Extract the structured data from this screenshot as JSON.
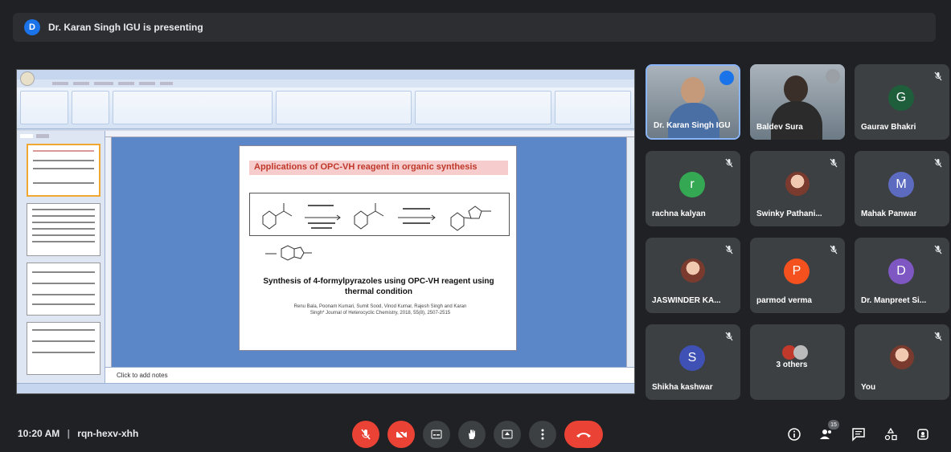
{
  "banner": {
    "avatar_letter": "D",
    "text": "Dr. Karan Singh IGU is presenting"
  },
  "presentation": {
    "slide_title": "Applications of OPC-VH reagent in organic synthesis",
    "slide_subtitle": "Synthesis of 4-formylpyrazoles using OPC-VH reagent using thermal condition",
    "citation_line1": "Renu Bala, Poonam Kumari, Sumit Sood, Vinod Kumar, Rajesh Singh and Karan",
    "citation_line2": "Singh* Journal of Heterocyclic Chemistry, 2018, 55(8), 2507-2515",
    "notes_placeholder": "Click to add notes"
  },
  "participants": [
    {
      "name": "Dr. Karan Singh IGU",
      "type": "video",
      "speaking": true
    },
    {
      "name": "Baldev Sura",
      "type": "video",
      "speaking": false
    },
    {
      "name": "Gaurav Bhakri",
      "letter": "G",
      "color": "#1e5e3b",
      "muted": true
    },
    {
      "name": "rachna kalyan",
      "letter": "r",
      "color": "#34a853",
      "muted": true
    },
    {
      "name": "Swinky Pathani...",
      "type": "photo",
      "muted": true
    },
    {
      "name": "Mahak Panwar",
      "letter": "M",
      "color": "#5c6bc0",
      "muted": true
    },
    {
      "name": "JASWINDER KA...",
      "type": "photo",
      "muted": true
    },
    {
      "name": "parmod verma",
      "letter": "P",
      "color": "#f4511e",
      "muted": true
    },
    {
      "name": "Dr. Manpreet Si...",
      "letter": "D",
      "color": "#7e57c2",
      "muted": true
    },
    {
      "name": "Shikha kashwar",
      "letter": "S",
      "color": "#3f51b5",
      "muted": true
    },
    {
      "name": "3 others",
      "type": "others"
    },
    {
      "name": "You",
      "type": "photo",
      "muted": true
    }
  ],
  "bottom_bar": {
    "time": "10:20 AM",
    "separator": "|",
    "meeting_code": "rqn-hexv-xhh",
    "participant_count": "15"
  }
}
